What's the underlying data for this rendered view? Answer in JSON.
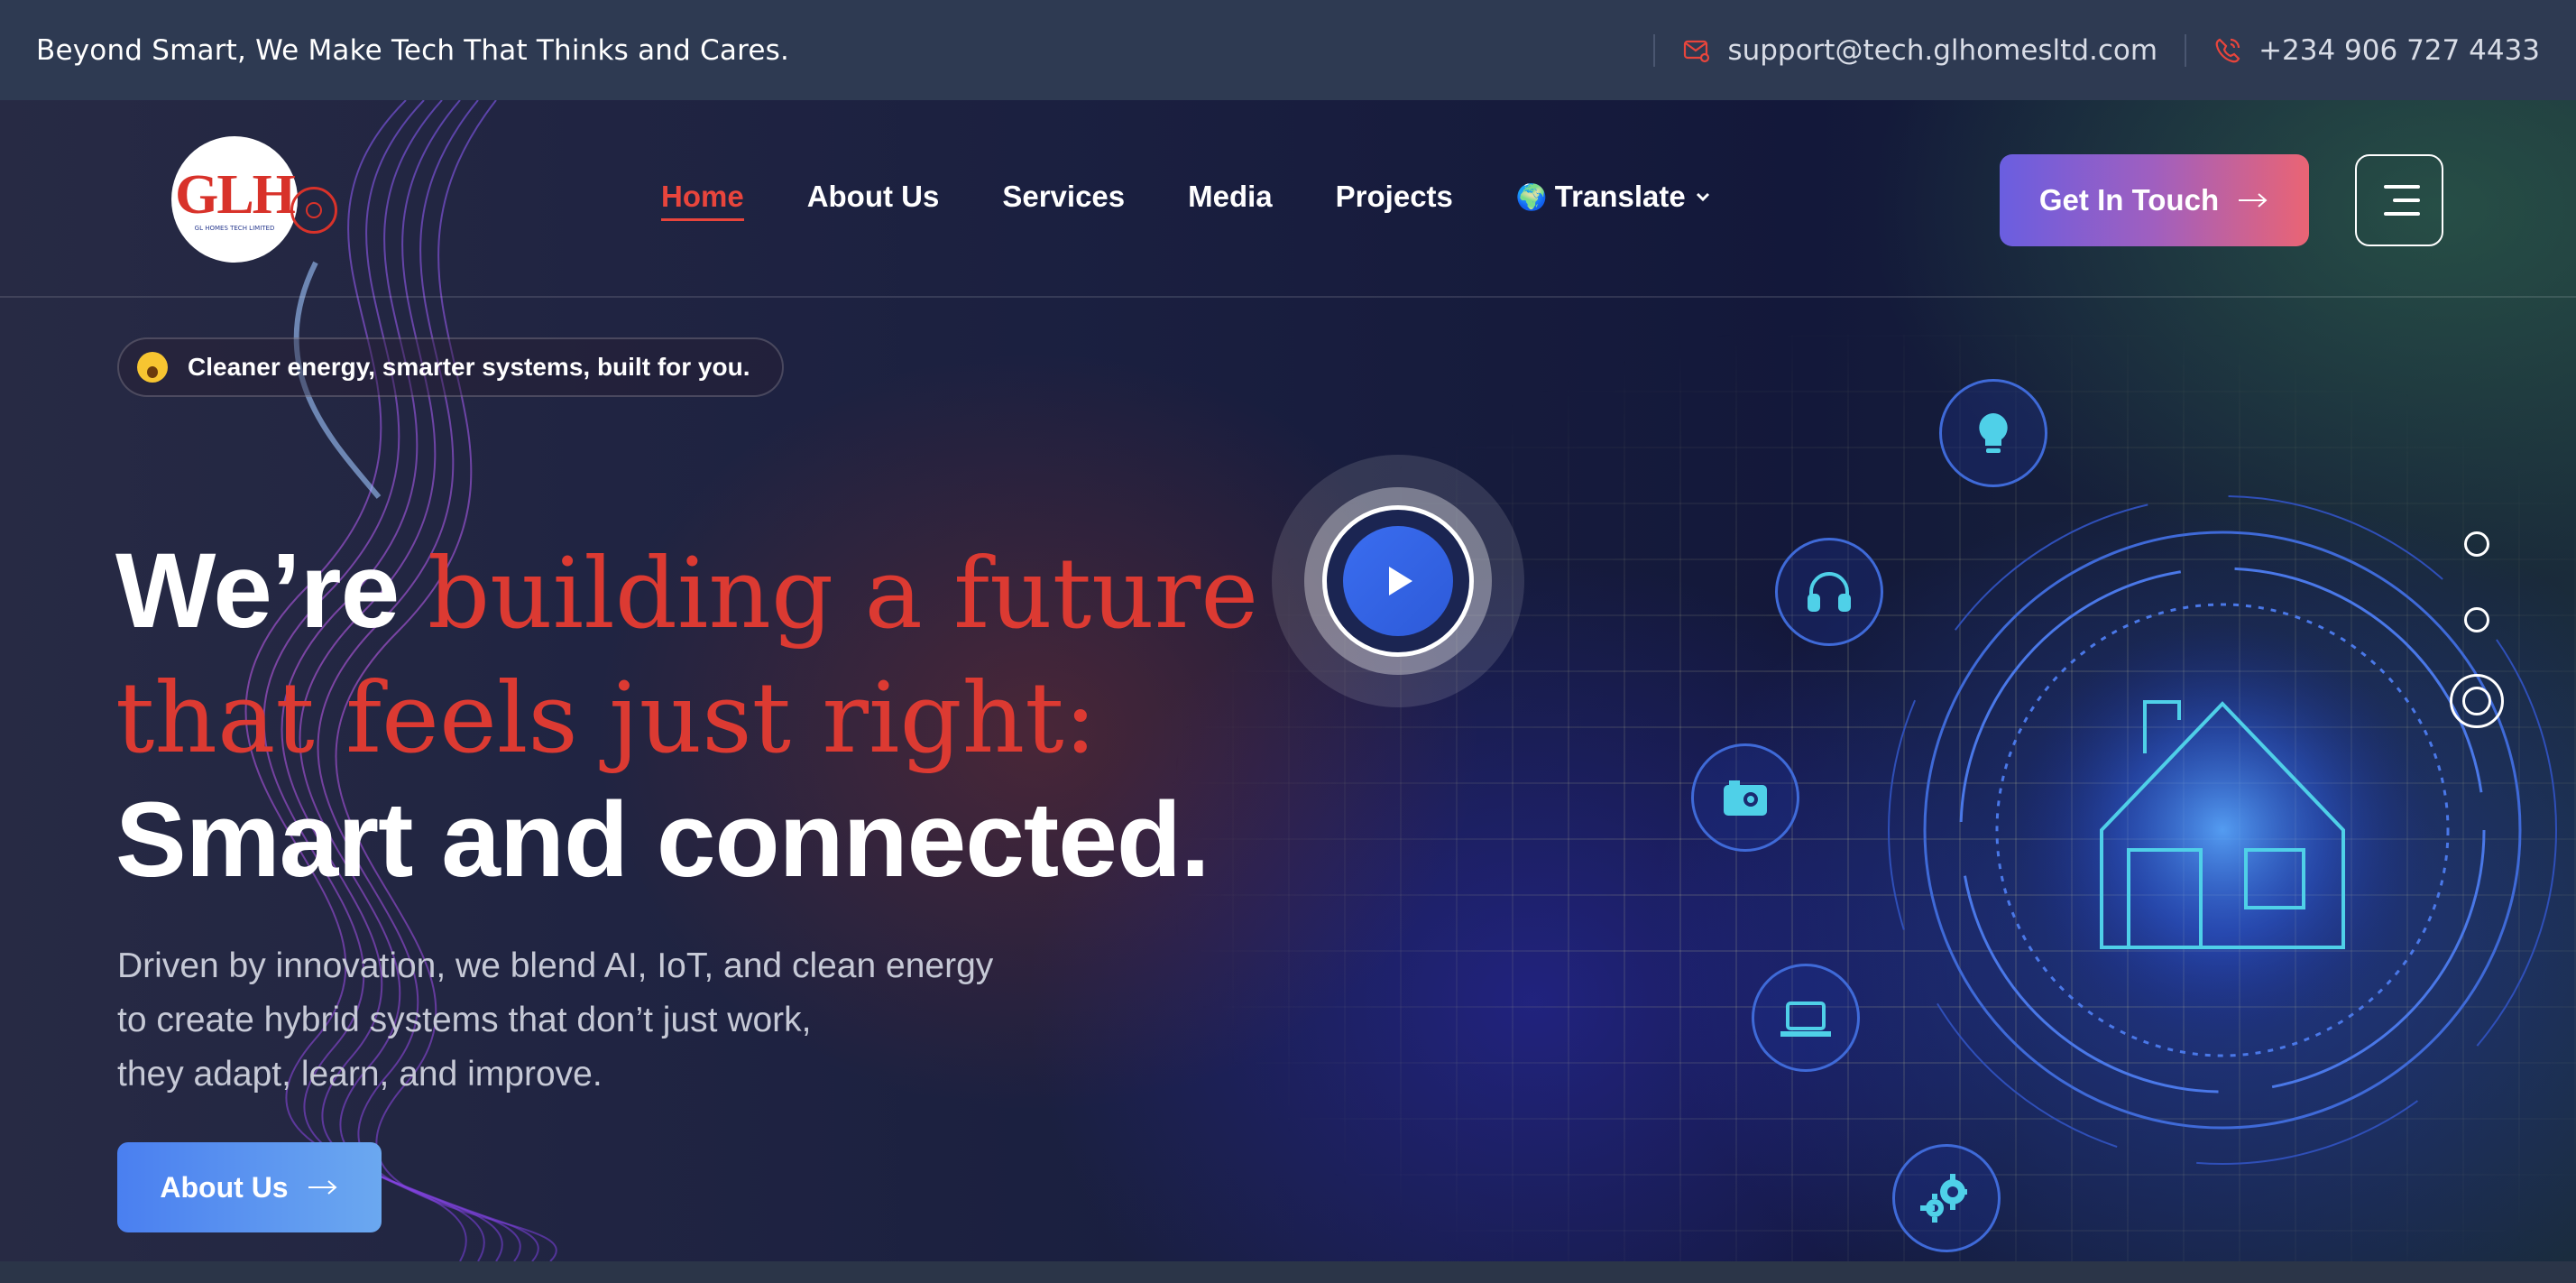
{
  "topbar": {
    "tagline": "Beyond Smart, We Make Tech That Thinks and Cares.",
    "email": "support@tech.glhomesltd.com",
    "phone": "+234 906 727 4433",
    "email_icon": "mail-icon",
    "phone_icon": "phone-icon"
  },
  "logo": {
    "mark_left": "G",
    "mark_mid": "L",
    "mark_right": "H",
    "sub": "GL HOMES TECH LIMITED"
  },
  "nav": {
    "items": [
      {
        "label": "Home",
        "active": true
      },
      {
        "label": "About Us"
      },
      {
        "label": "Services"
      },
      {
        "label": "Media"
      },
      {
        "label": "Projects"
      }
    ],
    "translate_label": "Translate",
    "cta_label": "Get In Touch"
  },
  "hero": {
    "badge": "Cleaner energy, smarter systems, built for you.",
    "headline_1": "We’re ",
    "headline_red_1": "building a future",
    "headline_red_2": "that feels just right:",
    "headline_3": "Smart and connected.",
    "lead_1": "Driven by innovation, we blend AI, IoT, and clean energy",
    "lead_2": "to create hybrid systems that don’t just work,",
    "lead_3": "they adapt, learn, and improve.",
    "button_label": "About Us"
  },
  "graphic_icons": [
    "lightbulb-icon",
    "headphones-icon",
    "camera-icon",
    "laptop-icon",
    "gears-icon",
    "house-icon"
  ],
  "colors": {
    "accent_red": "#dc3a32",
    "cta_from": "#6a5ee0",
    "cta_to": "#ea6474",
    "button_blue": "#4a7ff0",
    "topbar_bg": "#2e3a52"
  },
  "slider": {
    "total": 3,
    "active": 3
  }
}
